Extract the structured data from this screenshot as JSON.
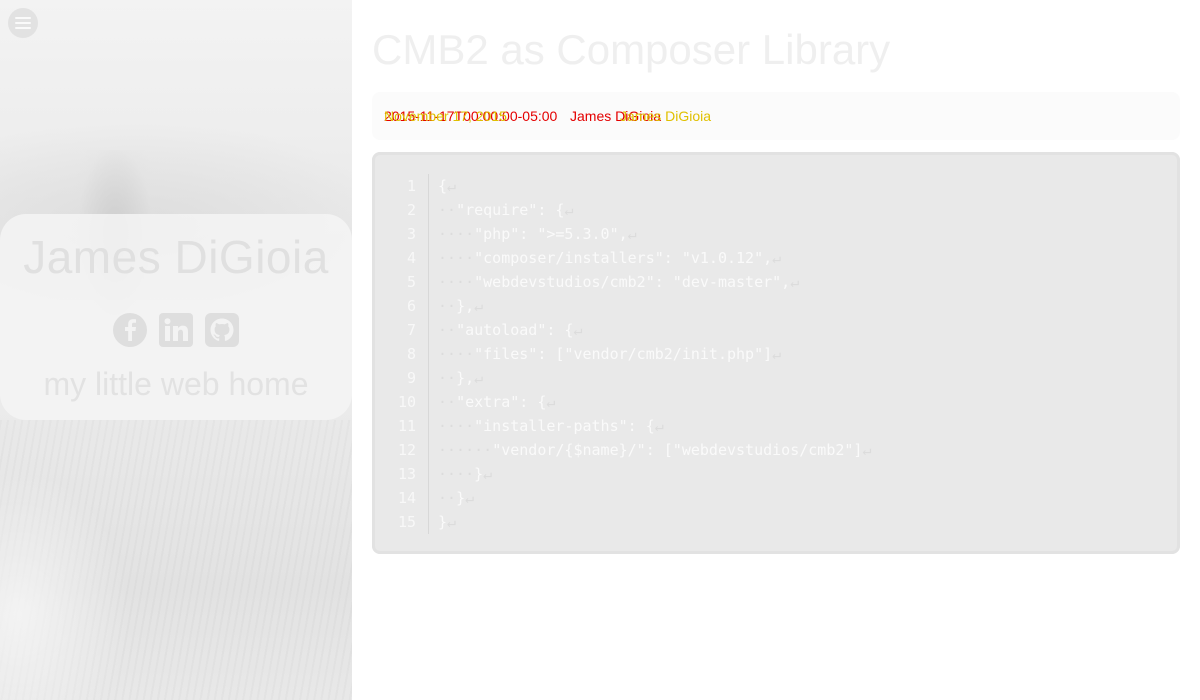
{
  "sidebar": {
    "site_name": "James DiGioia",
    "tagline": "my little web home",
    "social": [
      "facebook-icon",
      "linkedin-icon",
      "github-icon"
    ]
  },
  "post": {
    "title": "CMB2 as Composer Library",
    "meta_overlap": [
      "2015-11-17T00:00:00-05:00",
      "November 17, 2015",
      "James DiGioia",
      "James DiGioia"
    ]
  },
  "code": {
    "line_numbers": [
      "1",
      "2",
      "3",
      "4",
      "5",
      "6",
      "7",
      "8",
      "9",
      "10",
      "11",
      "12",
      "13",
      "14",
      "15"
    ],
    "lines": [
      {
        "indent": 0,
        "text": "{"
      },
      {
        "indent": 2,
        "text": "\"require\": {"
      },
      {
        "indent": 4,
        "text": "\"php\": \">=5.3.0\","
      },
      {
        "indent": 4,
        "text": "\"composer/installers\": \"v1.0.12\","
      },
      {
        "indent": 4,
        "text": "\"webdevstudios/cmb2\": \"dev-master\","
      },
      {
        "indent": 2,
        "text": "},"
      },
      {
        "indent": 2,
        "text": "\"autoload\": {"
      },
      {
        "indent": 4,
        "text": "\"files\": [\"vendor/cmb2/init.php\"]"
      },
      {
        "indent": 2,
        "text": "},"
      },
      {
        "indent": 2,
        "text": "\"extra\": {"
      },
      {
        "indent": 4,
        "text": "\"installer-paths\": {"
      },
      {
        "indent": 6,
        "text": "\"vendor/{$name}/\": [\"webdevstudios/cmb2\"]"
      },
      {
        "indent": 4,
        "text": "}"
      },
      {
        "indent": 2,
        "text": "}"
      },
      {
        "indent": 0,
        "text": "}"
      }
    ]
  },
  "colors": {
    "meta_red": "#e40000",
    "meta_yellow": "#e0c000",
    "code_bg": "#e9e9e9"
  }
}
